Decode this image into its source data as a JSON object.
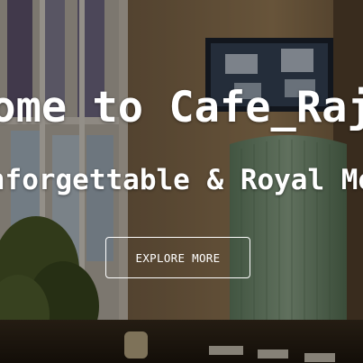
{
  "hero": {
    "title": "Welcome to Cafe_Rajwadi",
    "subtitle": "An Unforgettable & Royal Memory",
    "cta_label": "EXPLORE MORE"
  }
}
